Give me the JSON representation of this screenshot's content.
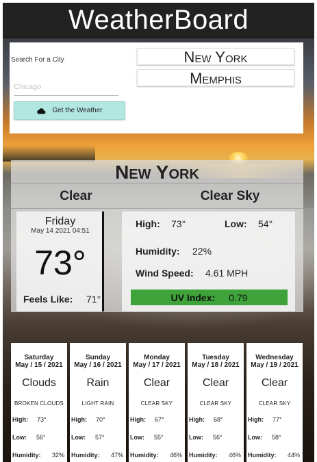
{
  "app": {
    "title": "WeatherBoard"
  },
  "search": {
    "label": "Search For a City",
    "placeholder": "Chicago",
    "button_label": "Get the Weather",
    "button_icon": "cloud-icon"
  },
  "history": [
    "New York",
    "Memphis"
  ],
  "current": {
    "city": "New York",
    "condition": "Clear",
    "description": "Clear Sky",
    "day": "Friday",
    "datetime": "May 14 2021 04:51",
    "temp": "73°",
    "feels_like_label": "Feels Like:",
    "feels_like": "71°",
    "high_label": "High:",
    "high": "73°",
    "low_label": "Low:",
    "low": "54°",
    "humidity_label": "Humidity:",
    "humidity": "22%",
    "wind_label": "Wind Speed:",
    "wind": "4.61 MPH",
    "uv_label": "UV Index:",
    "uv": "0.79",
    "uv_color": "#3ea33a"
  },
  "forecast": [
    {
      "day": "Saturday",
      "date": "May / 15 / 2021",
      "condition": "Clouds",
      "description": "BROKEN CLOUDS",
      "high_label": "High:",
      "high": "73°",
      "low_label": "Low:",
      "low": "56°",
      "humidity_label": "Humidity:",
      "humidity": "32%"
    },
    {
      "day": "Sunday",
      "date": "May / 16 / 2021",
      "condition": "Rain",
      "description": "LIGHT RAIN",
      "high_label": "High:",
      "high": "70°",
      "low_label": "Low:",
      "low": "57°",
      "humidity_label": "Humidity:",
      "humidity": "47%"
    },
    {
      "day": "Monday",
      "date": "May / 17 / 2021",
      "condition": "Clear",
      "description": "CLEAR SKY",
      "high_label": "High:",
      "high": "67°",
      "low_label": "Low:",
      "low": "55°",
      "humidity_label": "Humidity:",
      "humidity": "46%"
    },
    {
      "day": "Tuesday",
      "date": "May / 18 / 2021",
      "condition": "Clear",
      "description": "CLEAR SKY",
      "high_label": "High:",
      "high": "68°",
      "low_label": "Low:",
      "low": "56°",
      "humidity_label": "Humidity:",
      "humidity": "46%"
    },
    {
      "day": "Wednesday",
      "date": "May / 19 / 2021",
      "condition": "Clear",
      "description": "CLEAR SKY",
      "high_label": "High:",
      "high": "77°",
      "low_label": "Low:",
      "low": "58°",
      "humidity_label": "Humidity:",
      "humidity": "44%"
    }
  ]
}
